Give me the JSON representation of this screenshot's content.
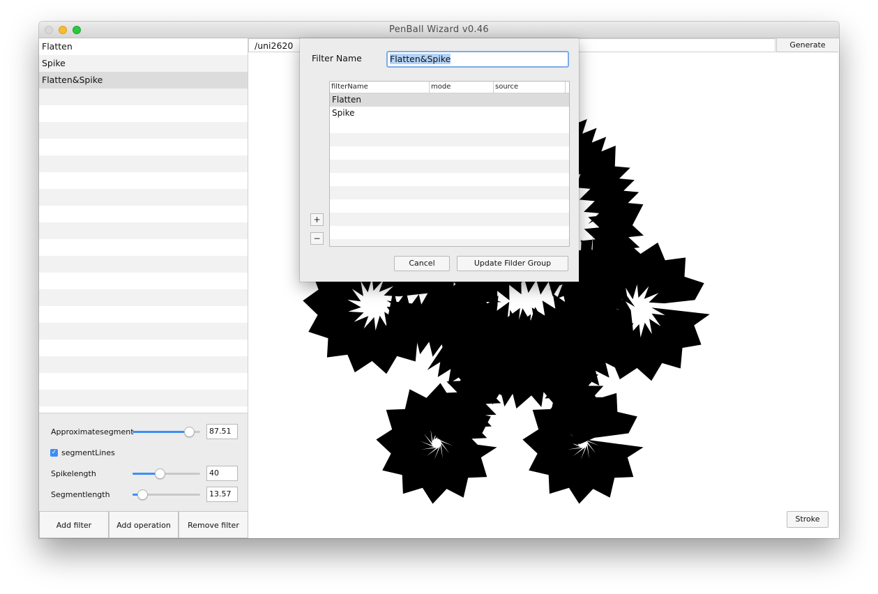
{
  "window": {
    "title": "PenBall Wizard v0.46"
  },
  "filters": [
    {
      "label": "Flatten"
    },
    {
      "label": "Spike"
    },
    {
      "label": "Flatten&Spike",
      "selected": true
    }
  ],
  "params": {
    "approx_label": "Approximatesegment",
    "approx_value": "87.51",
    "approx_level": 0.84,
    "segment_lines_label": "segmentLines",
    "segment_lines_checked": true,
    "spike_label": "Spikelength",
    "spike_value": "40",
    "spike_level": 0.4,
    "seglen_label": "Segmentlength",
    "seglen_value": "13.57",
    "seglen_level": 0.14
  },
  "buttons": {
    "add_filter": "Add filter",
    "add_operation": "Add operation",
    "remove_filter": "Remove filter",
    "generate": "Generate",
    "stroke": "Stroke"
  },
  "glyph_input": {
    "value": "/uni2620"
  },
  "dialog": {
    "name_label": "Filter Name",
    "name_value": "Flatten&Spike",
    "columns": [
      "filterName",
      "mode",
      "source"
    ],
    "rows": [
      "Flatten",
      "Spike"
    ],
    "add": "+",
    "remove": "−",
    "cancel": "Cancel",
    "update": "Update Filder Group"
  },
  "colors": {
    "accent": "#3b8ef3",
    "glyph": "#000000"
  }
}
